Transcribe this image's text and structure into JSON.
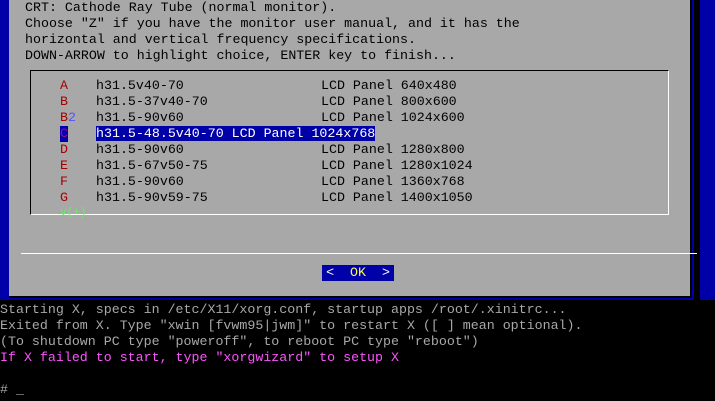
{
  "dialog": {
    "intro_lines": [
      "CRT: Cathode Ray Tube (normal monitor).",
      "Choose \"Z\" if you have the monitor user manual, and it has the",
      "horizontal and vertical frequency specifications.",
      "DOWN-ARROW to highlight choice, ENTER key to finish..."
    ],
    "options": [
      {
        "key": "A",
        "spec": "h31.5v40-70",
        "desc": "LCD Panel 640x480"
      },
      {
        "key": "B",
        "spec": "h31.5-37v40-70",
        "desc": "LCD Panel 800x600"
      },
      {
        "key": "B",
        "key_suffix": "2",
        "spec": "h31.5-90v60",
        "desc": "LCD Panel 1024x600"
      },
      {
        "key": "C",
        "spec": "h31.5-48.5v40-70",
        "desc": "LCD Panel 1024x768",
        "selected": true
      },
      {
        "key": "D",
        "spec": "h31.5-90v60",
        "desc": "LCD Panel 1280x800"
      },
      {
        "key": "E",
        "spec": "h31.5-67v50-75",
        "desc": "LCD Panel 1280x1024"
      },
      {
        "key": "F",
        "spec": "h31.5-90v60",
        "desc": "LCD Panel 1360x768"
      },
      {
        "key": "G",
        "spec": "h31.5-90v59-75",
        "desc": "LCD Panel 1400x1050"
      }
    ],
    "more_indicator": "v(+)",
    "ok_left": "<",
    "ok_label": "OK",
    "ok_right": ">"
  },
  "terminal": {
    "lines": [
      "Starting X, specs in /etc/X11/xorg.conf, startup apps /root/.xinitrc...",
      "Exited from X. Type \"xwin [fvwm95|jwm]\" to restart X ([ ] mean optional).",
      "(To shutdown PC type \"poweroff\", to reboot PC type \"reboot\")"
    ],
    "warning": "If X failed to start, type \"xorgwizard\" to setup X",
    "prompt": "# _"
  }
}
